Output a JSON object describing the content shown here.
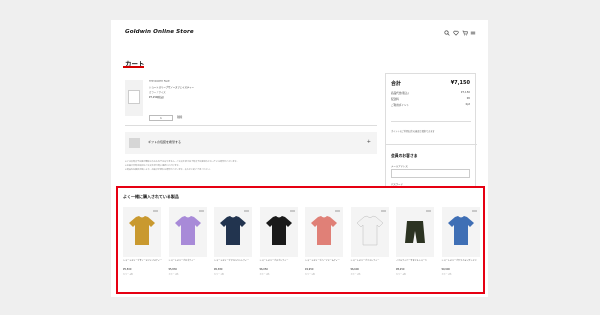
{
  "header": {
    "logo": "Goldwin Online Store",
    "icons": [
      "search-icon",
      "heart-icon",
      "cart-icon",
      "menu-icon"
    ]
  },
  "cart": {
    "title": "カート",
    "item": {
      "brand": "THE NORTH FACE",
      "name": "ショートスリーブザノースフェイスティー",
      "size": "カラー / サイズ",
      "price": "¥7,150(税込)",
      "quantity": "1",
      "delete_label": "削除"
    },
    "gift": {
      "label": "ギフトの包装を希望する",
      "toggle": "+"
    },
    "notes": [
      "※ご注文時点で在庫が確保されるものではありません。ご注文手続き完了時点で在庫切れとなっている場合がございます。",
      "※お届け日時の指定はご注文手続き時に選択いただけます。",
      "※商品の在庫状況等により、お届けが遅れる場合がございます。あらかじめご了承ください。"
    ]
  },
  "summary": {
    "total_label": "合計",
    "total_value": "¥7,150",
    "rows": [
      {
        "label": "商品代金(税込)",
        "value": "¥7,150"
      },
      {
        "label": "配送料",
        "value": "¥0"
      },
      {
        "label": "ご利用ポイント",
        "value": "0pt"
      }
    ],
    "note": "ポイントのご利用は次の画面で選択できます",
    "member_title": "会員のお客さま",
    "email_label": "メールアドレス",
    "password_label": "パスワード"
  },
  "recommend": {
    "title": "よく一緒に購入されている製品",
    "items": [
      {
        "name": "ショートスリーブザノースフェイスティー",
        "price": "¥5,500",
        "sub": "カラー 4色",
        "color": "#c9992f"
      },
      {
        "name": "ショートスリーブロゴティー",
        "price": "¥5,830",
        "sub": "カラー 3色",
        "color": "#a88ad8"
      },
      {
        "name": "ショートスリーブアロハベントティー",
        "price": "¥6,380",
        "sub": "カラー 2色",
        "color": "#22344f"
      },
      {
        "name": "ショートスリーブヌプシティー",
        "price": "¥6,050",
        "sub": "カラー 3色",
        "color": "#1a1a1a"
      },
      {
        "name": "ショートスリーブハーフドームティー",
        "price": "¥4,950",
        "sub": "カラー 5色",
        "color": "#e08077"
      },
      {
        "name": "ショートスリーブフォトティー",
        "price": "¥6,600",
        "sub": "カラー 2色",
        "color": "#f2f2f2"
      },
      {
        "name": "ノベルティバーサタイルショーツ",
        "price": "¥8,250",
        "sub": "カラー 4色",
        "color": "#2c3322"
      },
      {
        "name": "ショートスリーブクライミングシャツ",
        "price": "¥9,900",
        "sub": "カラー 2色",
        "color": "#3f6fb5"
      }
    ]
  }
}
